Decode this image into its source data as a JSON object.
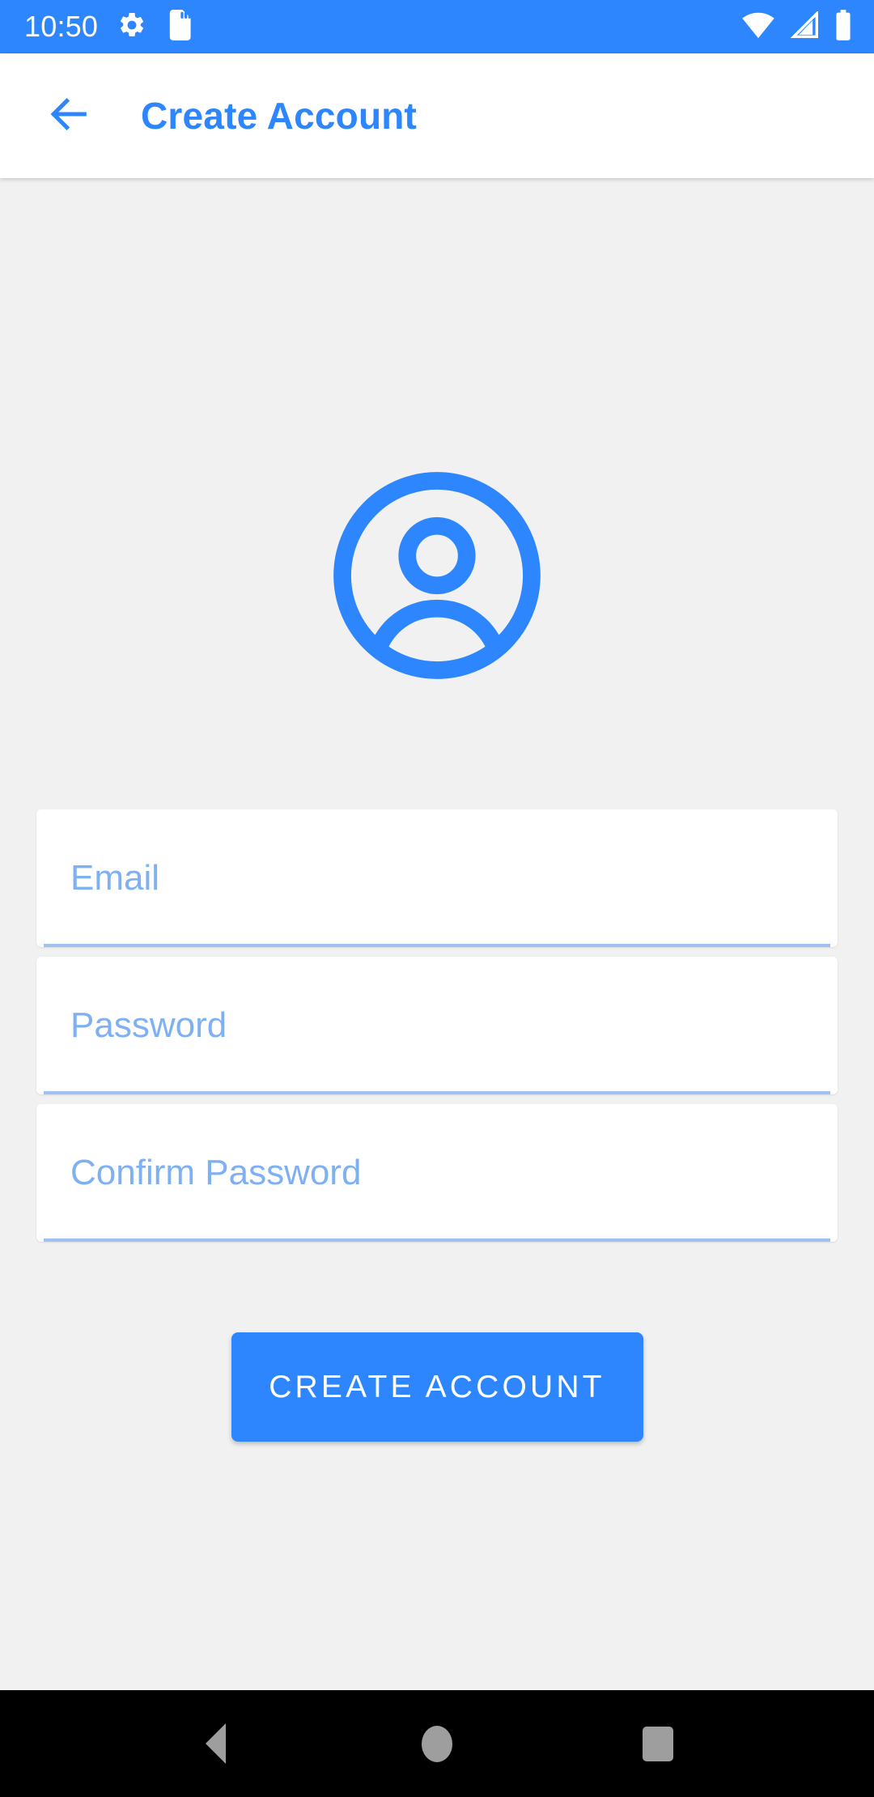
{
  "status_bar": {
    "time": "10:50",
    "background_color": "#2d86fd",
    "icons": [
      {
        "name": "settings-gear-icon",
        "label": "Settings"
      },
      {
        "name": "sd-card-icon",
        "label": "SD card"
      },
      {
        "name": "wifi-icon",
        "label": "Wi-Fi signal full"
      },
      {
        "name": "cellular-signal-icon",
        "label": "Mobile signal"
      },
      {
        "name": "battery-icon",
        "label": "Battery full"
      }
    ]
  },
  "app_bar": {
    "title": "Create Account",
    "back_label": "Back",
    "title_color": "#2d86fd",
    "background_color": "#ffffff"
  },
  "content": {
    "background_color": "#f1f1f1",
    "avatar": {
      "name": "account-avatar-icon",
      "color": "#2d86fd"
    },
    "fields": [
      {
        "name": "email-field",
        "placeholder": "Email",
        "value": "",
        "type": "email"
      },
      {
        "name": "password-field",
        "placeholder": "Password",
        "value": "",
        "type": "password"
      },
      {
        "name": "confirm-password-field",
        "placeholder": "Confirm Password",
        "value": "",
        "type": "password"
      }
    ],
    "placeholder_color": "#7fb0f2",
    "underline_color": "#9fc2f2",
    "submit_button": {
      "label": "CREATE ACCOUNT",
      "background_color": "#2d86fd",
      "text_color": "#ffffff"
    }
  },
  "nav_bar": {
    "background_color": "#000000",
    "icon_color": "#9e9e9e",
    "buttons": [
      {
        "name": "nav-back-button",
        "label": "Back"
      },
      {
        "name": "nav-home-button",
        "label": "Home"
      },
      {
        "name": "nav-recents-button",
        "label": "Recents"
      }
    ]
  }
}
